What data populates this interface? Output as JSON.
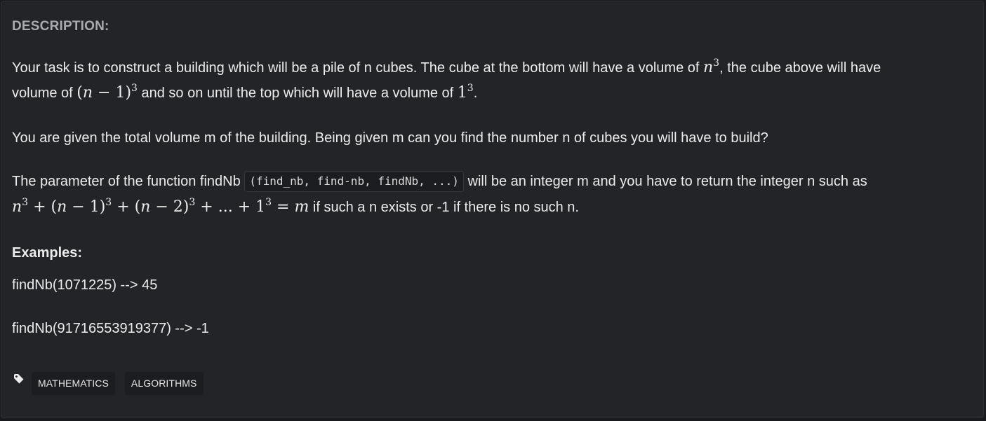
{
  "description": {
    "heading": "DESCRIPTION:",
    "p1_text_a": "Your task is to construct a building which will be a pile of n cubes. The cube at the bottom will have a volume of ",
    "p1_text_b": ", the cube above will have",
    "p1_line2_a": "volume of ",
    "p1_line2_b": " and so on until the top which will have a volume of ",
    "p1_line2_c": ".",
    "p2": "You are given the total volume m of the building. Being given m can you find the number n of cubes you will have to build?",
    "p3_text_a": "The parameter of the function findNb ",
    "p3_code": "(find_nb, find-nb, findNb, ...)",
    "p3_text_b": " will be an integer m and you have to return the integer n such as",
    "p3_line2": " if such a n exists or -1 if there is no such n.",
    "math_n": "n",
    "math_cube": "3",
    "math_n_minus_1": "(n − 1)",
    "math_one": "1",
    "formula_parts": {
      "t1": "n",
      "t2": " + (",
      "t3": "n",
      "t4": " − 1)",
      "t5": " + (",
      "t6": "n",
      "t7": " − 2)",
      "t8": " + ... + 1",
      "t9": " = ",
      "t10": "m",
      "exp": "3"
    }
  },
  "examples": {
    "title": "Examples:",
    "items": [
      "findNb(1071225) --> 45",
      "findNb(91716553919377) --> -1"
    ]
  },
  "tags": {
    "icon": "tag-icon",
    "items": [
      "MATHEMATICS",
      "ALGORITHMS"
    ]
  }
}
